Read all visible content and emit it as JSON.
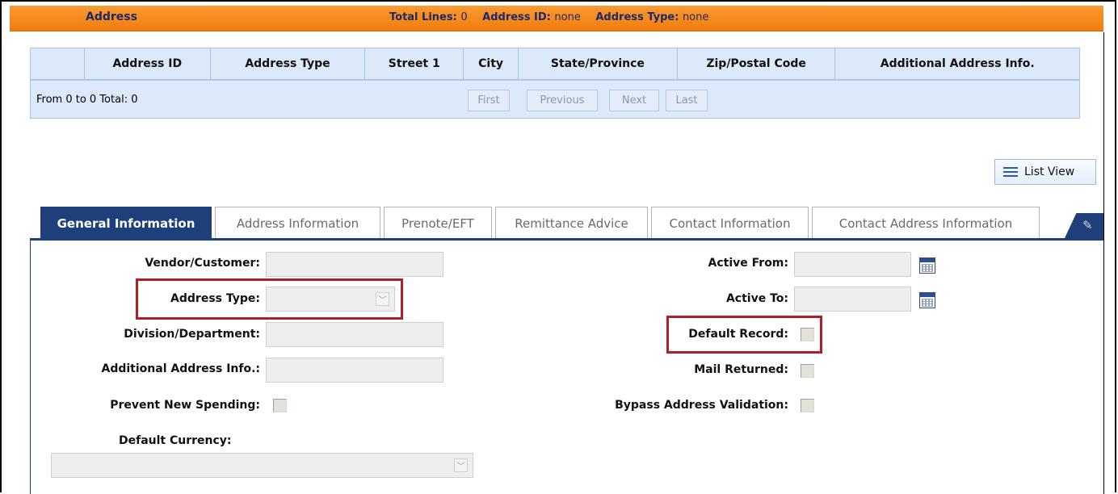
{
  "header": {
    "title": "Address",
    "total_lines_label": "Total Lines:",
    "total_lines_value": "0",
    "address_id_label": "Address ID:",
    "address_id_value": "none",
    "address_type_label": "Address Type:",
    "address_type_value": "none"
  },
  "grid": {
    "columns": [
      "Address ID",
      "Address Type",
      "Street 1",
      "City",
      "State/Province",
      "Zip/Postal Code",
      "Additional Address Info."
    ],
    "pager_info": "From 0 to 0 Total: 0",
    "first": "First",
    "previous": "Previous",
    "next": "Next",
    "last": "Last"
  },
  "list_view_label": "List View",
  "tabs": [
    "General Information",
    "Address Information",
    "Prenote/EFT",
    "Remittance Advice",
    "Contact Information",
    "Contact Address Information"
  ],
  "form": {
    "vendor_customer": "Vendor/Customer:",
    "address_type": "Address Type:",
    "division_department": "Division/Department:",
    "additional_address_info": "Additional Address Info.:",
    "prevent_new_spending": "Prevent New Spending:",
    "default_currency": "Default Currency:",
    "active_from": "Active From:",
    "active_to": "Active To:",
    "default_record": "Default Record:",
    "mail_returned": "Mail Returned:",
    "bypass_address_validation": "Bypass Address Validation:"
  },
  "colors": {
    "header_orange": "#f58a1f",
    "tab_active": "#1e3f7a",
    "grid_blue": "#dbe9fb",
    "highlight_red": "#b01e28"
  }
}
